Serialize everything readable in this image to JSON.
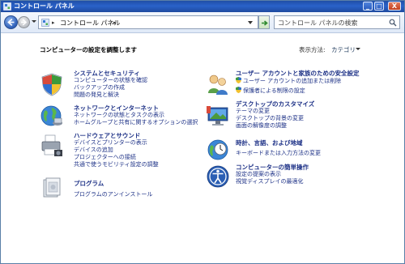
{
  "window": {
    "title": "コントロール パネル",
    "minimize": "_",
    "maximize": "□",
    "close": "X"
  },
  "nav": {
    "address_sep": "▸",
    "address_path": "コントロール パネル",
    "search_placeholder": "コントロール パネルの検索"
  },
  "content": {
    "heading": "コンピューターの設定を調整します",
    "view_by_label": "表示方法:",
    "view_by_value": "カテゴリ"
  },
  "categories": {
    "system": {
      "title": "システムとセキュリティ",
      "links": [
        "コンピューターの状態を確認",
        "バックアップの作成",
        "問題の発見と解決"
      ]
    },
    "network": {
      "title": "ネットワークとインターネット",
      "links": [
        "ネットワークの状態とタスクの表示",
        "ホームグループと共有に関するオプションの選択"
      ]
    },
    "hardware": {
      "title": "ハードウェアとサウンド",
      "links": [
        "デバイスとプリンターの表示",
        "デバイスの追加",
        "プロジェクターへの接続",
        "共通で使うモビリティ設定の調整"
      ]
    },
    "programs": {
      "title": "プログラム",
      "links": [
        "プログラムのアンインストール"
      ]
    },
    "users": {
      "title": "ユーザー アカウントと家族のための安全設定",
      "links": [
        "ユーザー アカウントの追加または削除",
        "保護者による制限の設定"
      ]
    },
    "appearance": {
      "title": "デスクトップのカスタマイズ",
      "links": [
        "テーマの変更",
        "デスクトップの背景の変更",
        "画面の解像度の調整"
      ]
    },
    "clock": {
      "title": "時計、言語、および地域",
      "links": [
        "キーボードまたは入力方法の変更"
      ]
    },
    "ease": {
      "title": "コンピューターの簡単操作",
      "links": [
        "設定の提案の表示",
        "視覚ディスプレイの最適化"
      ]
    }
  }
}
